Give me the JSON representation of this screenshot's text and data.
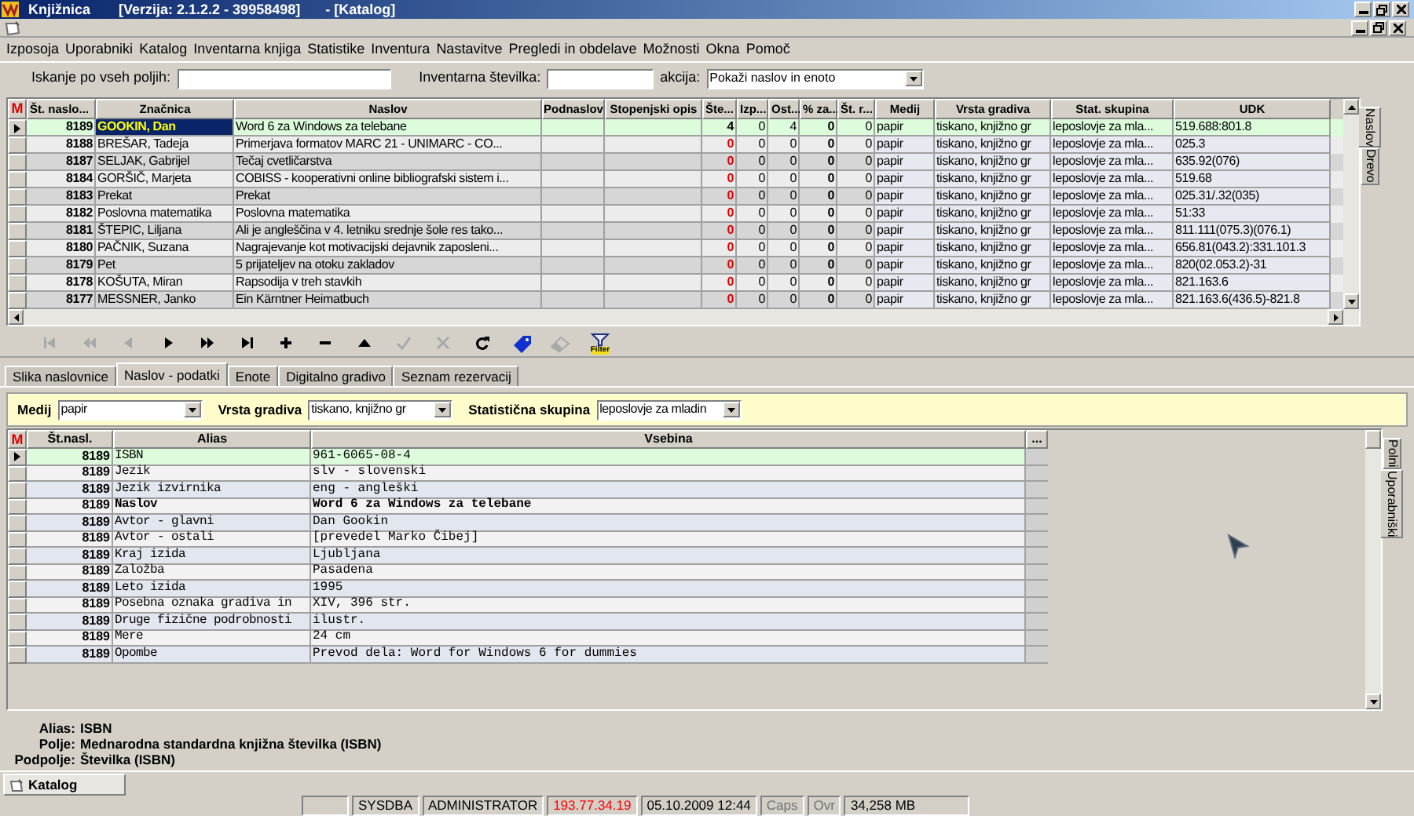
{
  "window": {
    "app": "Knjižnica",
    "version": "[Verzija: 2.1.2.2 - 39958498]",
    "document": "- [Katalog]"
  },
  "menu": [
    "Izposoja",
    "Uporabniki",
    "Katalog",
    "Inventarna knjiga",
    "Statistike",
    "Inventura",
    "Nastavitve",
    "Pregledi in obdelave",
    "Možnosti",
    "Okna",
    "Pomoč"
  ],
  "search": {
    "all_label": "Iskanje po vseh poljih:",
    "inventory_label": "Inventarna številka:",
    "action_label": "akcija:",
    "action_value": "Pokaži naslov in enoto"
  },
  "titles_grid": {
    "marker": "M",
    "columns": [
      "Št. naslo...",
      "Značnica",
      "Naslov",
      "Podnaslov",
      "Stopenjski opis",
      "Šte...",
      "Izp...",
      "Ost...",
      "% za...",
      "Št. r...",
      "Medij",
      "Vrsta gradiva",
      "Stat. skupina",
      "UDK"
    ],
    "rows": [
      {
        "selected": true,
        "st": "8189",
        "znacnica": "GOOKIN, Dan",
        "naslov": "Word 6 za Windows za telebane",
        "ste": "4",
        "ste_warning": false,
        "izp": "0",
        "ost": "4",
        "za": "0",
        "str": "0",
        "medij": "papir",
        "vrsta": "tiskano, knjižno gr",
        "stat": "leposlovje za mla...",
        "udk": "519.688:801.8"
      },
      {
        "selected": false,
        "st": "8188",
        "znacnica": "BREŠAR, Tadeja",
        "naslov": "Primerjava formatov MARC 21 - UNIMARC - CO...",
        "ste": "0",
        "ste_warning": true,
        "izp": "0",
        "ost": "0",
        "za": "0",
        "str": "0",
        "medij": "papir",
        "vrsta": "tiskano, knjižno gr",
        "stat": "leposlovje za mla...",
        "udk": "025.3"
      },
      {
        "selected": false,
        "st": "8187",
        "znacnica": "SELJAK, Gabrijel",
        "naslov": "Tečaj cvetličarstva",
        "ste": "0",
        "ste_warning": true,
        "izp": "0",
        "ost": "0",
        "za": "0",
        "str": "0",
        "medij": "papir",
        "vrsta": "tiskano, knjižno gr",
        "stat": "leposlovje za mla...",
        "udk": "635.92(076)"
      },
      {
        "selected": false,
        "st": "8184",
        "znacnica": "GORŠIČ, Marjeta",
        "naslov": "COBISS - kooperativni online bibliografski sistem i...",
        "ste": "0",
        "ste_warning": true,
        "izp": "0",
        "ost": "0",
        "za": "0",
        "str": "0",
        "medij": "papir",
        "vrsta": "tiskano, knjižno gr",
        "stat": "leposlovje za mla...",
        "udk": "519.68"
      },
      {
        "selected": false,
        "st": "8183",
        "znacnica": "Prekat",
        "naslov": "Prekat",
        "ste": "0",
        "ste_warning": true,
        "izp": "0",
        "ost": "0",
        "za": "0",
        "str": "0",
        "medij": "papir",
        "vrsta": "tiskano, knjižno gr",
        "stat": "leposlovje za mla...",
        "udk": "025.31/.32(035)"
      },
      {
        "selected": false,
        "st": "8182",
        "znacnica": "Poslovna matematika",
        "naslov": "Poslovna matematika",
        "ste": "0",
        "ste_warning": true,
        "izp": "0",
        "ost": "0",
        "za": "0",
        "str": "0",
        "medij": "papir",
        "vrsta": "tiskano, knjižno gr",
        "stat": "leposlovje za mla...",
        "udk": "51:33"
      },
      {
        "selected": false,
        "st": "8181",
        "znacnica": "ŠTEPIC, Liljana",
        "naslov": "Ali je angleščina v 4. letniku srednje šole res tako...",
        "ste": "0",
        "ste_warning": true,
        "izp": "0",
        "ost": "0",
        "za": "0",
        "str": "0",
        "medij": "papir",
        "vrsta": "tiskano, knjižno gr",
        "stat": "leposlovje za mla...",
        "udk": "811.111(075.3)(076.1)"
      },
      {
        "selected": false,
        "st": "8180",
        "znacnica": "PAČNIK, Suzana",
        "naslov": "Nagrajevanje kot motivacijski dejavnik zaposleni...",
        "ste": "0",
        "ste_warning": true,
        "izp": "0",
        "ost": "0",
        "za": "0",
        "str": "0",
        "medij": "papir",
        "vrsta": "tiskano, knjižno gr",
        "stat": "leposlovje za mla...",
        "udk": "656.81(043.2):331.101.3"
      },
      {
        "selected": false,
        "st": "8179",
        "znacnica": "Pet",
        "naslov": "5 prijateljev na otoku zakladov",
        "ste": "0",
        "ste_warning": true,
        "izp": "0",
        "ost": "0",
        "za": "0",
        "str": "0",
        "medij": "papir",
        "vrsta": "tiskano, knjižno gr",
        "stat": "leposlovje za mla...",
        "udk": "820(02.053.2)-31"
      },
      {
        "selected": false,
        "st": "8178",
        "znacnica": "KOŠUTA, Miran",
        "naslov": "Rapsodija v treh stavkih",
        "ste": "0",
        "ste_warning": true,
        "izp": "0",
        "ost": "0",
        "za": "0",
        "str": "0",
        "medij": "papir",
        "vrsta": "tiskano, knjižno gr",
        "stat": "leposlovje za mla...",
        "udk": "821.163.6"
      },
      {
        "selected": false,
        "st": "8177",
        "znacnica": "MESSNER, Janko",
        "naslov": "Ein Kärntner Heimatbuch",
        "ste": "0",
        "ste_warning": true,
        "izp": "0",
        "ost": "0",
        "za": "0",
        "str": "0",
        "medij": "papir",
        "vrsta": "tiskano, knjižno gr",
        "stat": "leposlovje za mla...",
        "udk": "821.163.6(436.5)-821.8"
      }
    ]
  },
  "upper_side_tabs": [
    {
      "label": "Naslov",
      "selected": true
    },
    {
      "label": "Drevo",
      "selected": false
    }
  ],
  "toolbar": [
    {
      "kind": "first",
      "disabled": true
    },
    {
      "kind": "prev_page",
      "disabled": true
    },
    {
      "kind": "prev",
      "disabled": true
    },
    {
      "kind": "next",
      "disabled": false
    },
    {
      "kind": "next_page",
      "disabled": false
    },
    {
      "kind": "last",
      "disabled": false
    },
    {
      "kind": "add",
      "disabled": false
    },
    {
      "kind": "remove",
      "disabled": false
    },
    {
      "kind": "up",
      "disabled": false
    },
    {
      "kind": "check",
      "disabled": true
    },
    {
      "kind": "cancel",
      "disabled": true
    },
    {
      "kind": "refresh",
      "disabled": false
    },
    {
      "kind": "tag",
      "disabled": false
    },
    {
      "kind": "eraser",
      "disabled": true
    },
    {
      "kind": "filter",
      "disabled": false,
      "label": "Filter"
    }
  ],
  "tabs": [
    {
      "label": "Slika naslovnice",
      "selected": false
    },
    {
      "label": "Naslov - podatki",
      "selected": true
    },
    {
      "label": "Enote",
      "selected": false
    },
    {
      "label": "Digitalno gradivo",
      "selected": false
    },
    {
      "label": "Seznam rezervacij",
      "selected": false
    }
  ],
  "filters": [
    {
      "label": "Medij",
      "value": "papir"
    },
    {
      "label": "Vrsta gradiva",
      "value": "tiskano, knjižno gr"
    },
    {
      "label": "Statistična skupina",
      "value": "leposlovje za mladin"
    }
  ],
  "fields_grid": {
    "marker": "M",
    "columns": [
      "Št.nasl.",
      "Alias",
      "Vsebina"
    ],
    "more": "...",
    "rows": [
      {
        "selected": true,
        "bold": false,
        "st": "8189",
        "alias": "ISBN",
        "value": "961-6065-08-4"
      },
      {
        "selected": false,
        "bold": false,
        "st": "8189",
        "alias": "Jezik",
        "value": "slv - slovenski"
      },
      {
        "selected": false,
        "bold": false,
        "st": "8189",
        "alias": "Jezik izvirnika",
        "value": "eng - angleški"
      },
      {
        "selected": false,
        "bold": true,
        "st": "8189",
        "alias": "Naslov",
        "value": "Word 6 za Windows za telebane"
      },
      {
        "selected": false,
        "bold": false,
        "st": "8189",
        "alias": "Avtor - glavni",
        "value": "Dan Gookin"
      },
      {
        "selected": false,
        "bold": false,
        "st": "8189",
        "alias": "Avtor - ostali",
        "value": "[prevedel Marko Čibej]"
      },
      {
        "selected": false,
        "bold": false,
        "st": "8189",
        "alias": "Kraj izida",
        "value": "Ljubljana"
      },
      {
        "selected": false,
        "bold": false,
        "st": "8189",
        "alias": "Založba",
        "value": "Pasadena"
      },
      {
        "selected": false,
        "bold": false,
        "st": "8189",
        "alias": "Leto izida",
        "value": "1995"
      },
      {
        "selected": false,
        "bold": false,
        "st": "8189",
        "alias": "Posebna oznaka gradiva in",
        "value": "XIV, 396 str."
      },
      {
        "selected": false,
        "bold": false,
        "st": "8189",
        "alias": "Druge fizične podrobnosti",
        "value": "ilustr."
      },
      {
        "selected": false,
        "bold": false,
        "st": "8189",
        "alias": "Mere",
        "value": "24 cm"
      },
      {
        "selected": false,
        "bold": false,
        "st": "8189",
        "alias": "Opombe",
        "value": "Prevod dela: Word for Windows 6 for dummies"
      }
    ]
  },
  "lower_side_tabs": [
    {
      "label": "Polni",
      "selected": false
    },
    {
      "label": "Uporabniški",
      "selected": true
    }
  ],
  "info": [
    {
      "label": "Alias:",
      "value": "ISBN"
    },
    {
      "label": "Polje:",
      "value": "Mednarodna standardna knjižna številka (ISBN)"
    },
    {
      "label": "Podpolje:",
      "value": "Številka (ISBN)"
    }
  ],
  "taskbar": {
    "label": "Katalog"
  },
  "status_bar": [
    {
      "text": "SYSDBA",
      "color": "#000000"
    },
    {
      "text": "ADMINISTRATOR",
      "color": "#000000"
    },
    {
      "text": "193.77.34.19",
      "color": "#ff0000"
    },
    {
      "text": "05.10.2009 12:44",
      "color": "#000000"
    },
    {
      "text": "Caps",
      "color": "#707070"
    },
    {
      "text": "Ovr",
      "color": "#707070"
    },
    {
      "text": "34,258 MB",
      "color": "#000000"
    }
  ]
}
